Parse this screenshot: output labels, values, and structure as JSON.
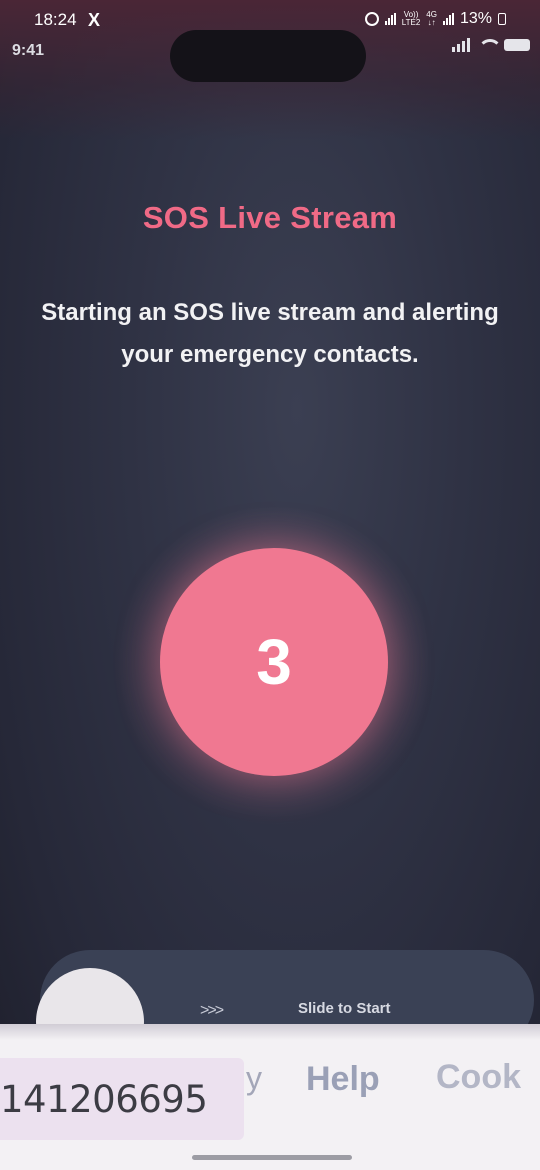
{
  "outer_status": {
    "time": "18:24",
    "x_icon": "X",
    "network_top": "Vo))",
    "network_bottom": "LTE2",
    "network_gen_top": "4G",
    "network_gen_bottom": "↓↑",
    "battery": "13%"
  },
  "inner_status": {
    "time": "9:41"
  },
  "screen": {
    "title": "SOS Live Stream",
    "subtitle": "Starting an SOS live stream and alerting your emergency contacts.",
    "countdown": "3",
    "slider_arrows": ">>>",
    "slider_label": "Slide to Start"
  },
  "bottom_overlay": {
    "id_text": "141206695",
    "nav_partial": "y",
    "nav_help": "Help",
    "nav_cookies": "Cook"
  },
  "colors": {
    "accent": "#f07891",
    "title": "#f06a86",
    "background": "#2b2d3d"
  },
  "icons": [
    "x-logo-icon",
    "alarm-icon",
    "signal-icon",
    "battery-icon",
    "wifi-icon"
  ]
}
